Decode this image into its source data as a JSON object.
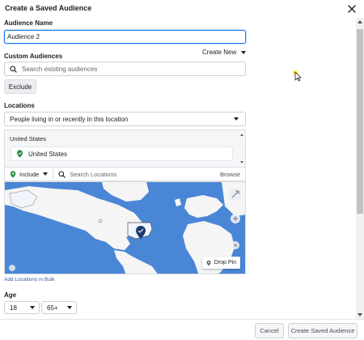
{
  "dialog": {
    "title": "Create a Saved Audience"
  },
  "audience_name": {
    "label": "Audience Name",
    "value": "Audience 2"
  },
  "custom_audiences": {
    "label": "Custom Audiences",
    "create_new_label": "Create New",
    "search_placeholder": "Search existing audiences",
    "exclude_label": "Exclude"
  },
  "locations": {
    "label": "Locations",
    "mode_selected": "People living in or recently in this location",
    "country_header": "United States",
    "selected_location": "United States",
    "include_label": "Include",
    "search_placeholder": "Search Locations",
    "browse_label": "Browse",
    "drop_pin_label": "Drop Pin",
    "add_bulk_label": "Add Locations in Bulk"
  },
  "age": {
    "label": "Age",
    "min": "18",
    "max": "65+"
  },
  "footer": {
    "cancel_label": "Cancel",
    "create_label": "Create Saved Audience"
  },
  "colors": {
    "accent": "#1877f2",
    "include_green": "#1a8f3c",
    "link": "#385898",
    "map_water": "#4a86d6",
    "map_land": "#f5f5f5"
  }
}
